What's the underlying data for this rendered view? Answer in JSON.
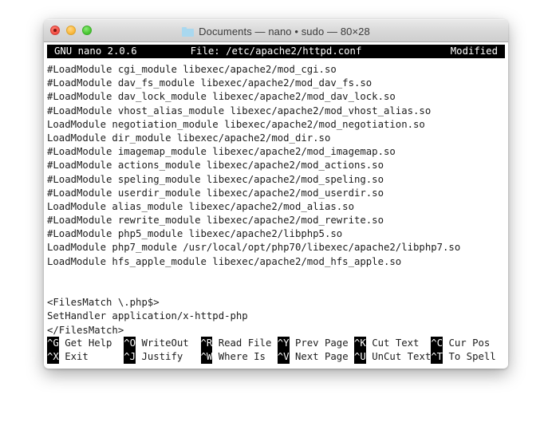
{
  "window": {
    "title": "Documents — nano • sudo — 80×28",
    "folder_icon": "folder-icon",
    "traffic_lights": [
      {
        "name": "close-button",
        "color": "#f8544a"
      },
      {
        "name": "minimize-button",
        "color": "#fcbb40"
      },
      {
        "name": "maximize-button",
        "color": "#4fcb37"
      }
    ]
  },
  "nano": {
    "version": "GNU nano 2.0.6",
    "file_label": "File: /etc/apache2/httpd.conf",
    "status": "Modified"
  },
  "editor": {
    "lines": [
      "#LoadModule cgi_module libexec/apache2/mod_cgi.so",
      "#LoadModule dav_fs_module libexec/apache2/mod_dav_fs.so",
      "#LoadModule dav_lock_module libexec/apache2/mod_dav_lock.so",
      "#LoadModule vhost_alias_module libexec/apache2/mod_vhost_alias.so",
      "LoadModule negotiation_module libexec/apache2/mod_negotiation.so",
      "LoadModule dir_module libexec/apache2/mod_dir.so",
      "#LoadModule imagemap_module libexec/apache2/mod_imagemap.so",
      "#LoadModule actions_module libexec/apache2/mod_actions.so",
      "#LoadModule speling_module libexec/apache2/mod_speling.so",
      "#LoadModule userdir_module libexec/apache2/mod_userdir.so",
      "LoadModule alias_module libexec/apache2/mod_alias.so",
      "#LoadModule rewrite_module libexec/apache2/mod_rewrite.so",
      "#LoadModule php5_module libexec/apache2/libphp5.so",
      "LoadModule php7_module /usr/local/opt/php70/libexec/apache2/libphp7.so",
      "LoadModule hfs_apple_module libexec/apache2/mod_hfs_apple.so",
      "",
      "",
      "<FilesMatch \\.php$>",
      "SetHandler application/x-httpd-php",
      "</FilesMatch>",
      "",
      ""
    ]
  },
  "shortcuts": {
    "row1": [
      {
        "key": "^G",
        "label": "Get Help"
      },
      {
        "key": "^O",
        "label": "WriteOut"
      },
      {
        "key": "^R",
        "label": "Read File"
      },
      {
        "key": "^Y",
        "label": "Prev Page"
      },
      {
        "key": "^K",
        "label": "Cut Text"
      },
      {
        "key": "^C",
        "label": "Cur Pos"
      }
    ],
    "row2": [
      {
        "key": "^X",
        "label": "Exit"
      },
      {
        "key": "^J",
        "label": "Justify"
      },
      {
        "key": "^W",
        "label": "Where Is"
      },
      {
        "key": "^V",
        "label": "Next Page"
      },
      {
        "key": "^U",
        "label": "UnCut Text"
      },
      {
        "key": "^T",
        "label": "To Spell"
      }
    ]
  }
}
